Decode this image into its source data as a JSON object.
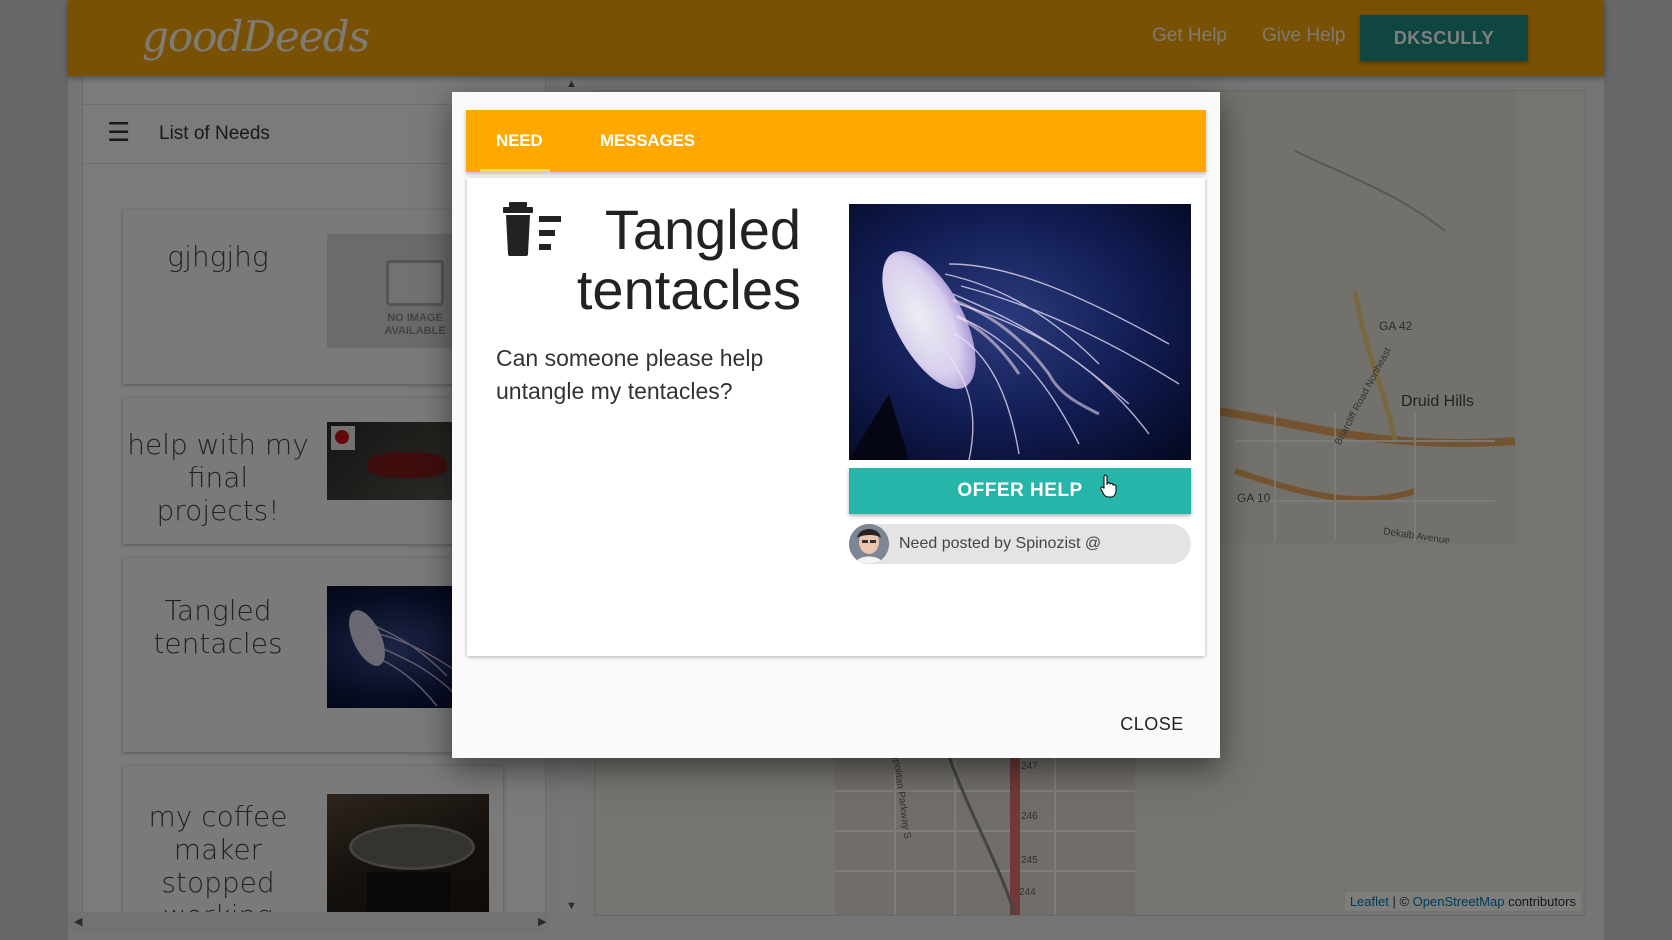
{
  "header": {
    "logo": "goodDeeds",
    "nav": {
      "get_help": "Get Help",
      "give_help": "Give Help"
    },
    "user_button": "DKSCULLY"
  },
  "sidebar": {
    "title": "List of Needs",
    "cards": [
      {
        "title": "gjhgjhg",
        "image": "no-image-placeholder",
        "placeholder_text": "NO IMAGE AVAILABLE"
      },
      {
        "title": "help with my final projects!",
        "image": "website-screenshot"
      },
      {
        "title": "Tangled tentacles",
        "image": "jellyfish-photo"
      },
      {
        "title": "my coffee maker stopped working",
        "image": "coffee-maker-photo"
      }
    ]
  },
  "map": {
    "labels": [
      "GA 42",
      "Druid Hills",
      "GA 10",
      "Briarcliff Road Northeast",
      "Dekalb Avenue",
      "Metropolitan Parkway S",
      "247",
      "246",
      "245",
      "244"
    ],
    "attribution": {
      "leaflet": "Leaflet",
      "separator": " | © ",
      "osm": "OpenStreetMap",
      "suffix": " contributors"
    }
  },
  "modal": {
    "tabs": [
      {
        "label": "NEED",
        "active": true
      },
      {
        "label": "MESSAGES",
        "active": false
      }
    ],
    "need_icon": "trash-list-icon",
    "title": "Tangled tentacles",
    "description": "Can someone please help untangle my tentacles?",
    "photo": "jellyfish-photo",
    "offer_button": "OFFER HELP",
    "posted_by": "Need posted by Spinozist @",
    "close_button": "CLOSE"
  },
  "colors": {
    "header": "#f0a20a",
    "tab_bar": "#ffa800",
    "teal_button": "#26b5a8",
    "user_button": "#1f8d83"
  }
}
